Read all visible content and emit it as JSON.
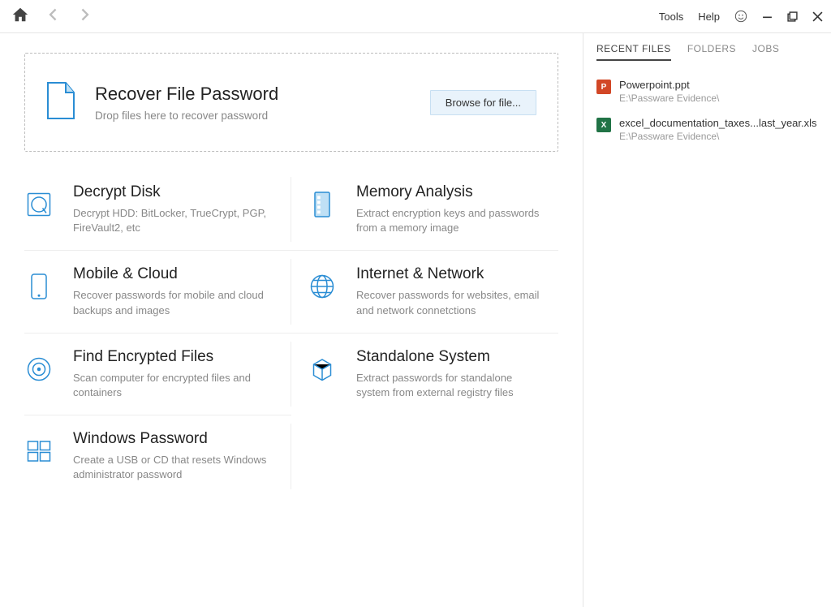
{
  "toolbar": {
    "tools_label": "Tools",
    "help_label": "Help"
  },
  "dropzone": {
    "title": "Recover File Password",
    "subtitle": "Drop files here to recover password",
    "browse_label": "Browse for file..."
  },
  "cards": [
    {
      "title": "Decrypt Disk",
      "desc": "Decrypt HDD: BitLocker, TrueCrypt, PGP, FireVault2, etc"
    },
    {
      "title": "Memory Analysis",
      "desc": "Extract encryption keys and passwords from a memory image"
    },
    {
      "title": "Mobile & Cloud",
      "desc": "Recover passwords for mobile and cloud backups and images"
    },
    {
      "title": "Internet & Network",
      "desc": "Recover passwords for websites, email and network connetctions"
    },
    {
      "title": "Find Encrypted Files",
      "desc": "Scan computer for encrypted files and containers"
    },
    {
      "title": "Standalone System",
      "desc": "Extract passwords for standalone system from external registry files"
    },
    {
      "title": "Windows Password",
      "desc": "Create a USB or CD that resets Windows administrator password"
    }
  ],
  "side": {
    "tabs": {
      "recent": "RECENT FILES",
      "folders": "FOLDERS",
      "jobs": "JOBS",
      "active": "recent"
    },
    "recent": [
      {
        "icon": "ppt",
        "name": "Powerpoint.ppt",
        "path": "E:\\Passware Evidence\\"
      },
      {
        "icon": "xls",
        "name": "excel_documentation_taxes...last_year.xls",
        "path": "E:\\Passware Evidence\\"
      }
    ]
  },
  "colors": {
    "accent": "#2a8dd4"
  }
}
